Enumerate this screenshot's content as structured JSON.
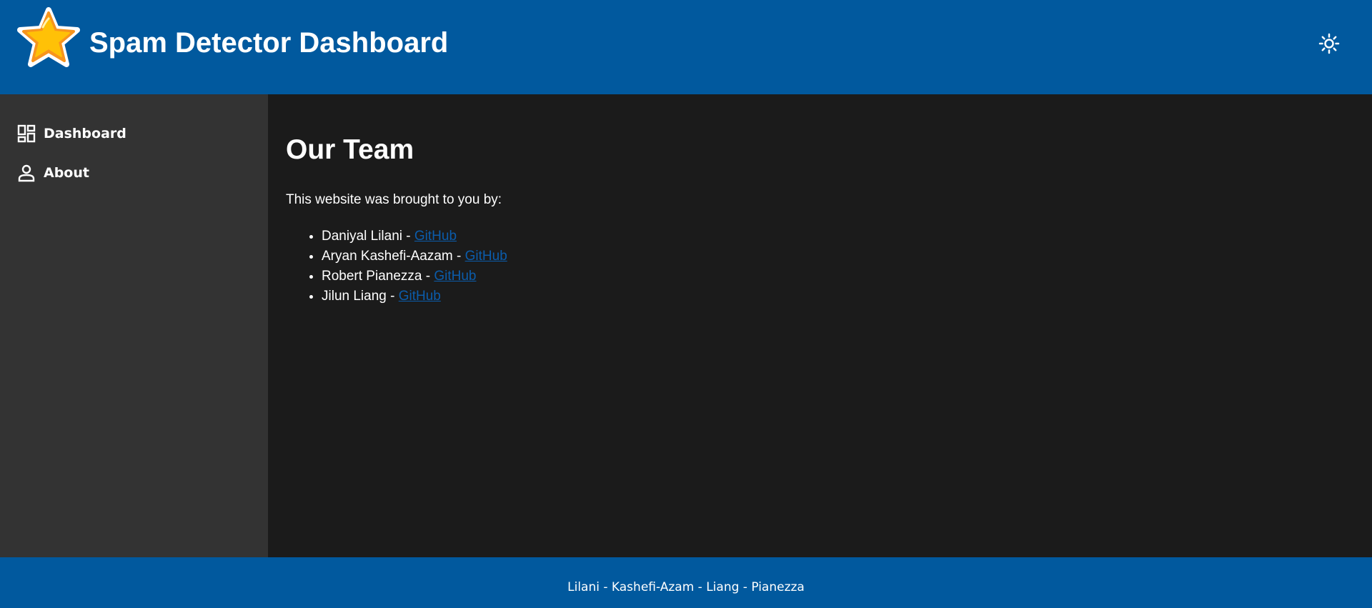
{
  "header": {
    "title": "Spam Detector Dashboard",
    "logo_icon": "star-icon",
    "theme_toggle_icon": "sun-icon"
  },
  "sidebar": {
    "items": [
      {
        "label": "Dashboard",
        "icon": "dashboard-icon"
      },
      {
        "label": "About",
        "icon": "person-icon"
      }
    ]
  },
  "main": {
    "title": "Our Team",
    "intro": "This website was brought to you by:",
    "team": [
      {
        "name": "Daniyal Lilani",
        "separator": " - ",
        "link": "GitHub"
      },
      {
        "name": "Aryan Kashefi-Aazam",
        "separator": " - ",
        "link": "GitHub"
      },
      {
        "name": "Robert Pianezza",
        "separator": " - ",
        "link": "GitHub"
      },
      {
        "name": "Jilun Liang",
        "separator": " - ",
        "link": "GitHub"
      }
    ]
  },
  "footer": {
    "text": "Lilani - Kashefi-Azam - Liang - Pianezza"
  },
  "colors": {
    "header_bg": "#01599e",
    "sidebar_bg": "#333333",
    "main_bg": "#1b1b1b",
    "link": "#0b5cab",
    "star_fill": "#ffc107",
    "star_outline": "#f7941d"
  }
}
